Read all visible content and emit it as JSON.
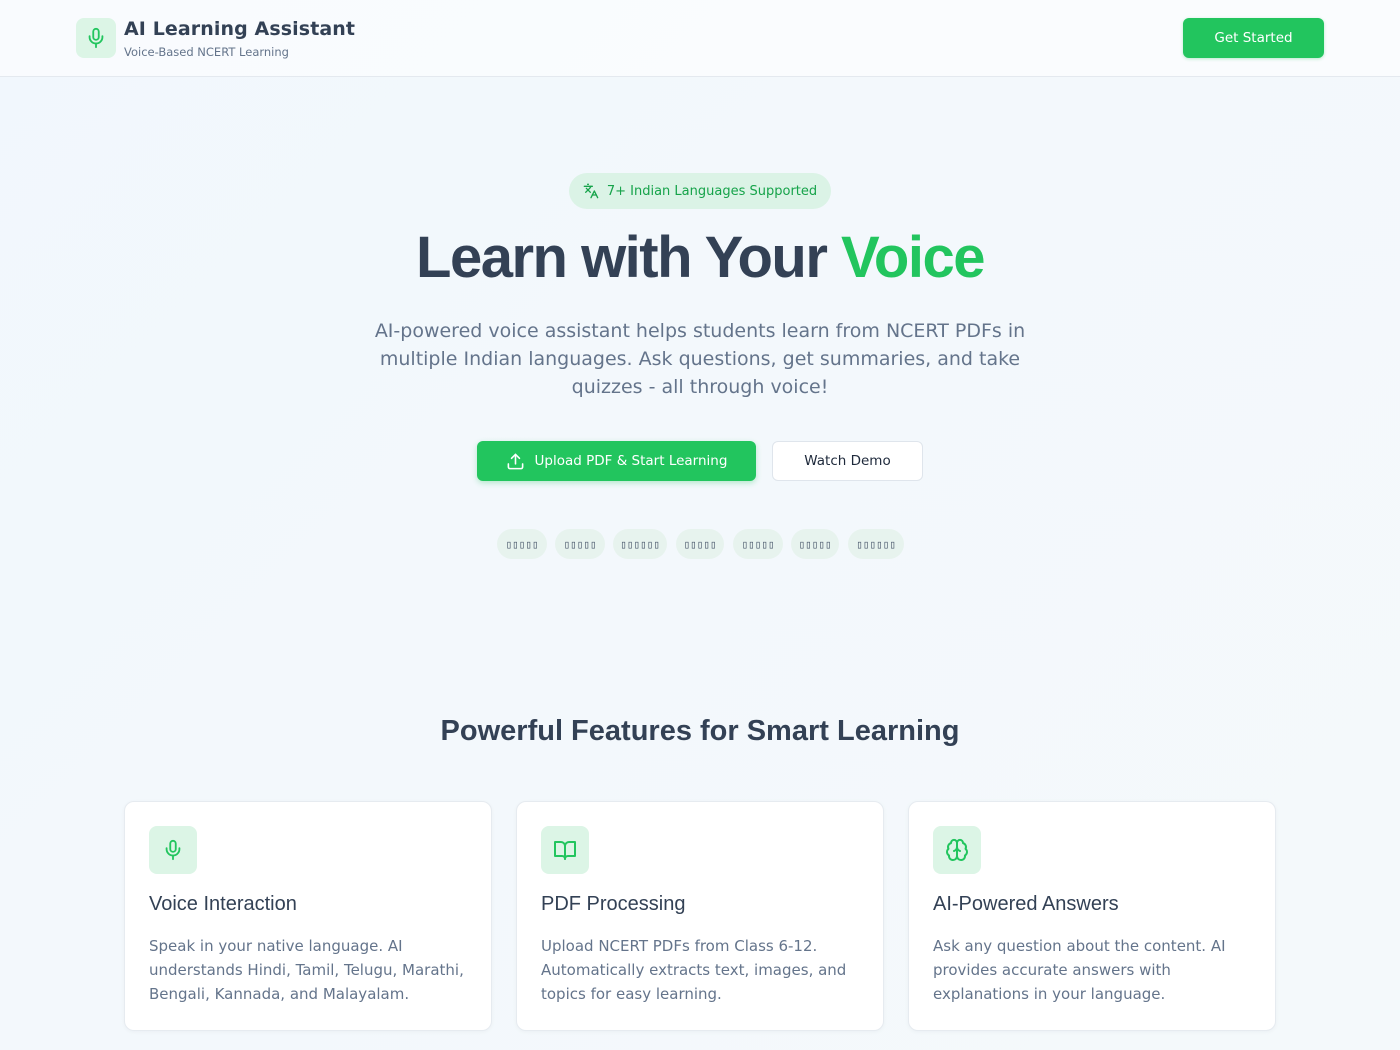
{
  "colors": {
    "accent": "#22c55e",
    "accent_soft": "#dcf5e6",
    "text": "#334155",
    "muted": "#64748b"
  },
  "header": {
    "title": "AI Learning Assistant",
    "subtitle": "Voice-Based NCERT Learning",
    "logo_icon": "microphone-icon",
    "cta_label": "Get Started"
  },
  "hero": {
    "badge_icon": "translate-icon",
    "badge_text": "7+ Indian Languages Supported",
    "title_main": "Learn with Your ",
    "title_accent": "Voice",
    "description": "AI-powered voice assistant helps students learn from NCERT PDFs in multiple Indian languages. Ask questions, get summaries, and take quizzes - all through voice!",
    "primary_button": "Upload PDF & Start Learning",
    "primary_button_icon": "upload-icon",
    "secondary_button": "Watch Demo",
    "languages": [
      "▯▯▯▯▯",
      "▯▯▯▯▯",
      "▯▯▯▯▯▯",
      "▯▯▯▯▯",
      "▯▯▯▯▯",
      "▯▯▯▯▯",
      "▯▯▯▯▯▯"
    ]
  },
  "features": {
    "title": "Powerful Features for Smart Learning",
    "cards": [
      {
        "icon": "microphone-icon",
        "title": "Voice Interaction",
        "description": "Speak in your native language. AI understands Hindi, Tamil, Telugu, Marathi, Bengali, Kannada, and Malayalam."
      },
      {
        "icon": "book-open-icon",
        "title": "PDF Processing",
        "description": "Upload NCERT PDFs from Class 6-12. Automatically extracts text, images, and topics for easy learning."
      },
      {
        "icon": "brain-icon",
        "title": "AI-Powered Answers",
        "description": "Ask any question about the content. AI provides accurate answers with explanations in your language."
      }
    ]
  }
}
